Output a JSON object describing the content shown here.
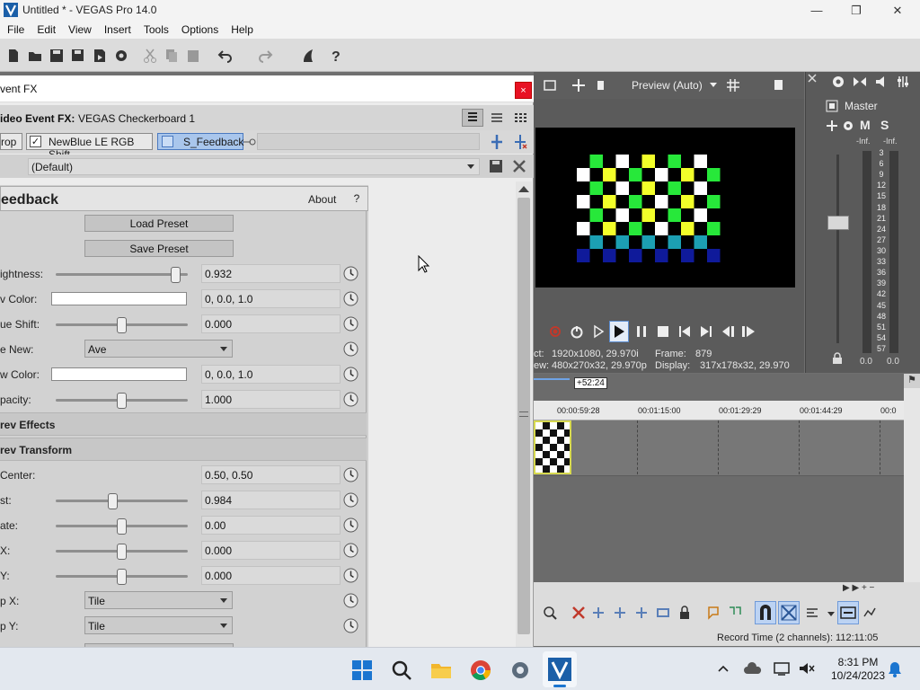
{
  "window": {
    "title": "Untitled * - VEGAS Pro 14.0",
    "minimize": "—",
    "maximize": "❐",
    "close": "✕"
  },
  "menu": [
    "File",
    "Edit",
    "View",
    "Insert",
    "Tools",
    "Options",
    "Help"
  ],
  "preview": {
    "quality": "Preview (Auto)",
    "info": {
      "project_label": "ct:",
      "project_value": "1920x1080, 29.970i",
      "frame_label": "Frame:",
      "frame_value": "879",
      "preview_label": "ew:",
      "preview_value": "480x270x32, 29.970p",
      "display_label": "Display:",
      "display_value": "317x178x32, 29.970"
    }
  },
  "mixer": {
    "master_label": "Master",
    "m_label": "M",
    "s_label": "S",
    "inf_left": "-Inf.",
    "inf_right": "-Inf.",
    "scale": [
      "3",
      "6",
      "9",
      "12",
      "15",
      "18",
      "21",
      "24",
      "27",
      "30",
      "33",
      "36",
      "39",
      "42",
      "45",
      "48",
      "51",
      "54",
      "57"
    ],
    "bottom_left": "0.0",
    "bottom_right": "0.0"
  },
  "timeline": {
    "cursor_time": "+52:24",
    "ruler": [
      "00:00:59:28",
      "00:01:15:00",
      "00:01:29:29",
      "00:01:44:29",
      "00:0"
    ]
  },
  "status_bar": {
    "record_time": "Record Time (2 channels): 112:11:05"
  },
  "fx_dialog": {
    "title": "vent FX",
    "close": "×",
    "header_label": "ideo Event FX:",
    "header_value": "VEGAS Checkerboard 1",
    "chain": [
      {
        "label": "rop"
      },
      {
        "label": "NewBlue LE RGB Shift"
      },
      {
        "label": "S_Feedback"
      }
    ],
    "preset": "(Default)",
    "plugin": {
      "name": "eedback",
      "about": "About",
      "help": "?",
      "load_preset": "Load Preset",
      "save_preset": "Save Preset",
      "rows": [
        {
          "label": "ightness:",
          "value": "0.932",
          "slider": 0.94
        },
        {
          "label": "v Color:",
          "value": "0, 0.0, 1.0"
        },
        {
          "label": "ue Shift:",
          "value": "0.000",
          "slider": 0.5
        },
        {
          "label": "e New:",
          "value": "Ave"
        },
        {
          "label": "w Color:",
          "value": "0, 0.0, 1.0"
        },
        {
          "label": "pacity:",
          "value": "1.000",
          "slider": 0.5
        },
        {
          "label": "rev Effects"
        },
        {
          "label": "rev Transform"
        },
        {
          "label": "Center:",
          "value": "0.50, 0.50"
        },
        {
          "label": "st:",
          "value": "0.984",
          "slider": 0.43
        },
        {
          "label": "ate:",
          "value": "0.00",
          "slider": 0.5
        },
        {
          "label": "X:",
          "value": "0.000",
          "slider": 0.5
        },
        {
          "label": "Y:",
          "value": "0.000",
          "slider": 0.5
        },
        {
          "label": "p X:",
          "value": "Tile"
        },
        {
          "label": "p Y:",
          "value": "Tile"
        }
      ]
    }
  },
  "taskbar": {
    "time": "8:31 PM",
    "date": "10/24/2023"
  },
  "colors": {
    "accent_blue": "#1b75d0",
    "record_red": "#c0392b",
    "plugin_tab": "#a9c6ec"
  }
}
